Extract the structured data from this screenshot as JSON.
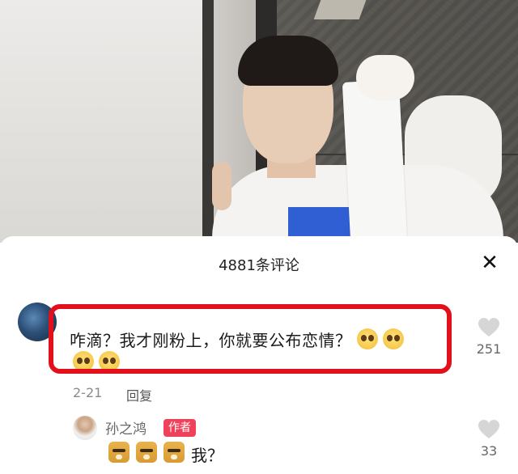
{
  "sheet": {
    "title": "4881条评论",
    "close_label": "✕"
  },
  "comment": {
    "text": "咋滴？我才刚粉上，你就要公布恋情？",
    "date": "2-21",
    "reply_label": "回复",
    "likes": "251",
    "trailing_emoji_count": 2,
    "wrapped_emoji_count": 2
  },
  "reply": {
    "author": "孙之鸿",
    "badge": "作者",
    "text": "我？",
    "likes": "33",
    "doge_emoji_count": 3
  },
  "colors": {
    "highlight_border": "#e3101b",
    "author_badge": "#f0415a"
  }
}
